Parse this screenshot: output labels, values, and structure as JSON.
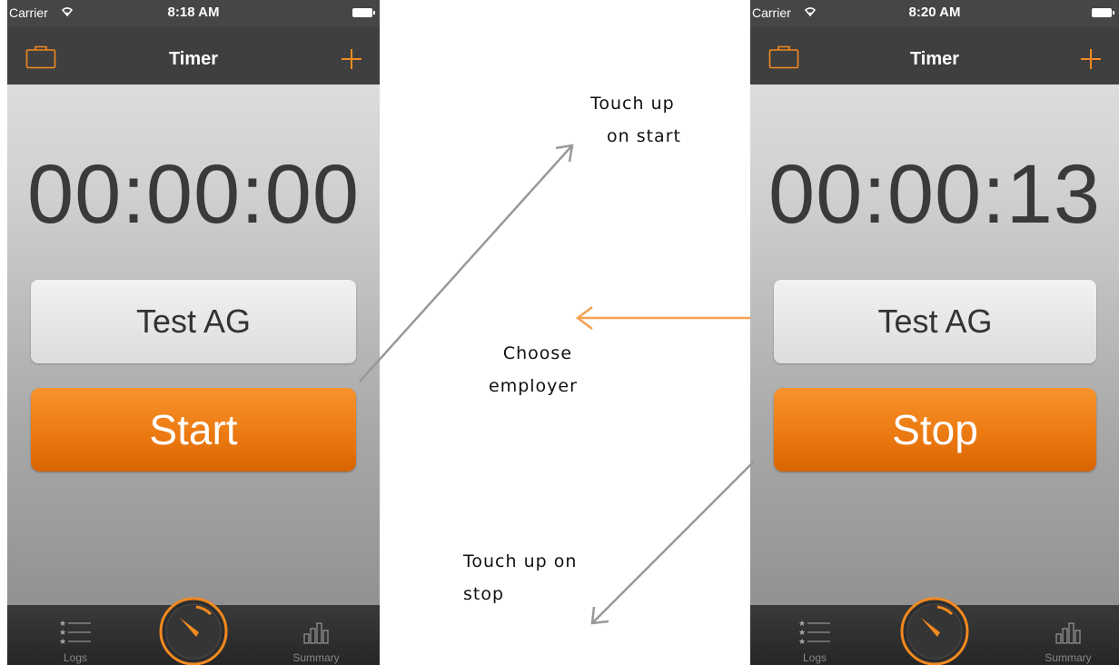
{
  "screens": [
    {
      "status": {
        "carrier": "Carrier",
        "time": "8:18 AM"
      },
      "nav": {
        "title": "Timer"
      },
      "clock": "00:00:00",
      "employer": "Test AG",
      "action": "Start",
      "tabs": {
        "logs": "Logs",
        "summary": "Summary"
      }
    },
    {
      "status": {
        "carrier": "Carrier",
        "time": "8:20 AM"
      },
      "nav": {
        "title": "Timer"
      },
      "clock": "00:00:13",
      "employer": "Test AG",
      "action": "Stop",
      "tabs": {
        "logs": "Logs",
        "summary": "Summary"
      }
    }
  ],
  "annotations": {
    "touch_start": [
      "Touch up",
      "on start"
    ],
    "choose_employer": [
      "Choose",
      "employer"
    ],
    "touch_stop": [
      "Touch up on",
      "stop"
    ]
  },
  "colors": {
    "accent": "#f28a1f",
    "gray_arrow": "#999999",
    "orange_arrow": "#f4a04f"
  },
  "icons": [
    "briefcase-icon",
    "plus-icon",
    "wifi-icon",
    "battery-icon",
    "logs-list-icon",
    "timer-dial-icon",
    "summary-bars-icon"
  ]
}
